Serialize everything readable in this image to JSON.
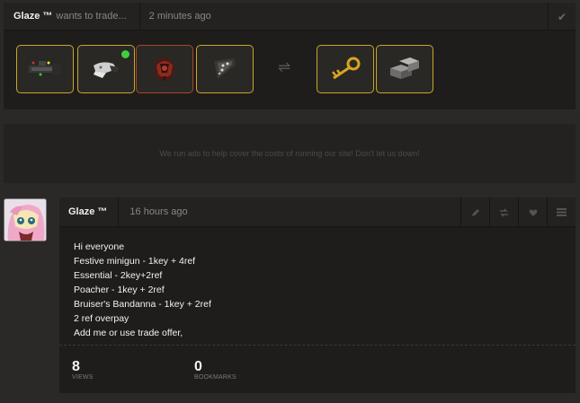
{
  "trade": {
    "user": "Glaze ™",
    "action": "wants to trade...",
    "time": "2 minutes ago",
    "items_offered": [
      {
        "name": "festive-minigun-icon",
        "border": "#c9a72a"
      },
      {
        "name": "bruisers-bandanna-icon",
        "border": "#c9a72a",
        "online_dot": true
      },
      {
        "name": "essential-accessories-icon",
        "border": "#a8452a"
      },
      {
        "name": "poacher-icon",
        "border": "#c9a72a"
      }
    ],
    "items_wanted": [
      {
        "name": "mann-co-key-icon",
        "border": "#c9a72a"
      },
      {
        "name": "refined-metal-icon",
        "border": "#c9a72a"
      }
    ]
  },
  "ad": {
    "text": "We run ads to help cover the costs of running our site! Don't let us down!"
  },
  "post": {
    "user": "Glaze ™",
    "time": "16 hours ago",
    "lines": [
      "Hi everyone",
      "Festive minigun - 1key + 4ref",
      "Essential - 2key+2ref",
      "Poacher - 1key + 2ref",
      "Bruiser's Bandanna - 1key + 2ref",
      "2 ref overpay",
      "Add me or use trade offer,"
    ],
    "views": {
      "value": "8",
      "label": "Views"
    },
    "bookmarks": {
      "value": "0",
      "label": "Bookmarks"
    }
  },
  "colors": {
    "background": "#2b2927",
    "card": "#1e1d1b",
    "unique_border": "#c9a72a",
    "strange_border": "#a8452a",
    "online": "#3fcf3f"
  }
}
